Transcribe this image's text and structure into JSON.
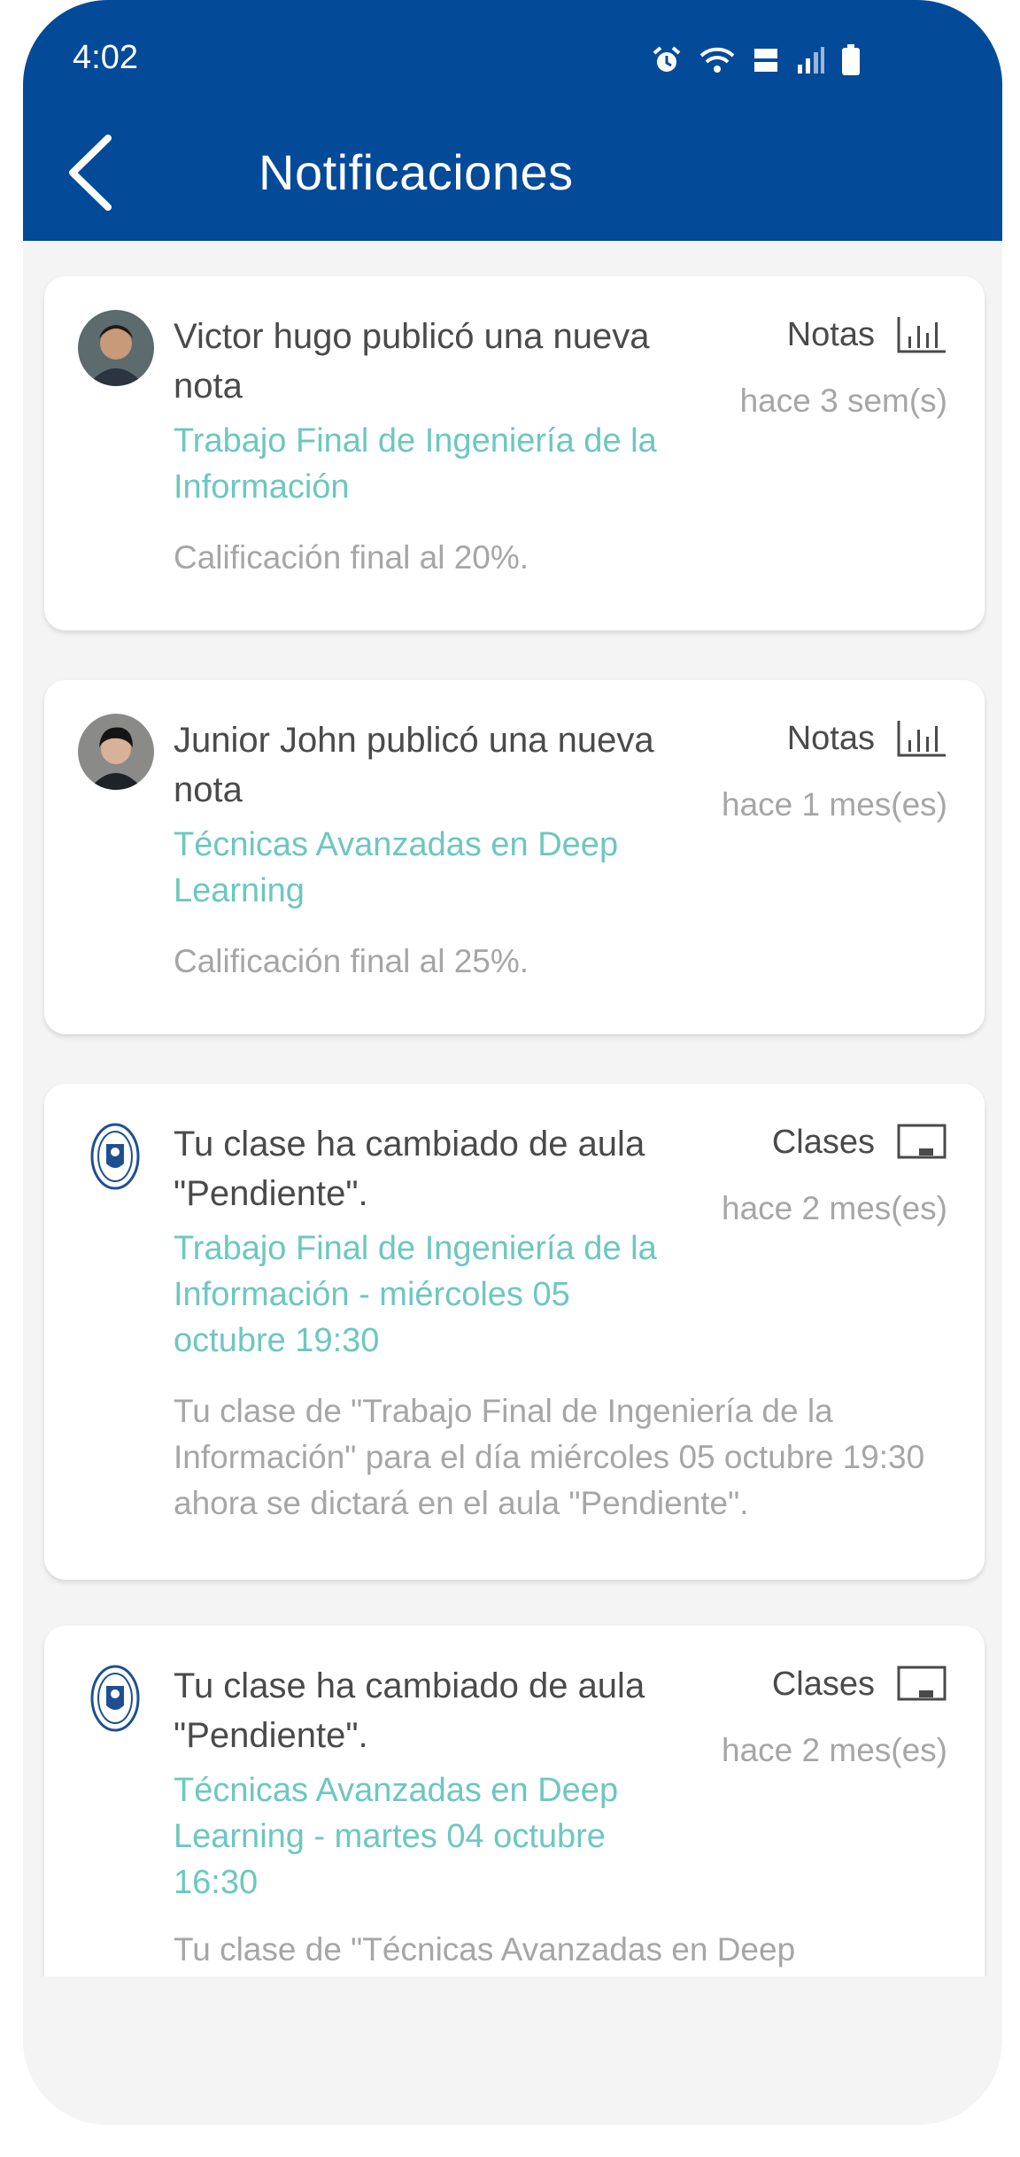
{
  "status": {
    "time": "4:02"
  },
  "header": {
    "title": "Notificaciones"
  },
  "notifications": [
    {
      "headline": "Victor  hugo publicó una nueva nota",
      "type": "Notas",
      "type_icon": "bar-chart-icon",
      "time_ago": "hace 3 sem(s)",
      "course": "Trabajo Final de Ingeniería de la Información",
      "detail": "Calificación final al 20%."
    },
    {
      "headline": "Junior John publicó una nueva nota",
      "type": "Notas",
      "type_icon": "bar-chart-icon",
      "time_ago": "hace 1 mes(es)",
      "course": "Técnicas Avanzadas en Deep Learning",
      "detail": "Calificación final al 25%."
    },
    {
      "headline": "Tu clase ha cambiado de aula \"Pendiente\".",
      "type": "Clases",
      "type_icon": "classroom-board-icon",
      "time_ago": "hace 2 mes(es)",
      "course": "Trabajo Final de Ingeniería de la Información - miércoles 05 octubre 19:30",
      "detail": "Tu clase de \"Trabajo Final de Ingeniería de la Información\" para el día miércoles 05 octubre 19:30 ahora se dictará en el aula \"Pendiente\"."
    },
    {
      "headline": "Tu clase ha cambiado de aula \"Pendiente\".",
      "type": "Clases",
      "type_icon": "classroom-board-icon",
      "time_ago": "hace 2 mes(es)",
      "course": "Técnicas Avanzadas en Deep Learning - martes 04 octubre 16:30",
      "detail": "Tu clase de \"Técnicas Avanzadas en Deep"
    }
  ],
  "colors": {
    "appbar": "#034a99",
    "course_link": "#6dc7bf",
    "muted_text": "#a6a6a6",
    "primary_text": "#4a4a4a",
    "background": "#f4f4f5"
  }
}
